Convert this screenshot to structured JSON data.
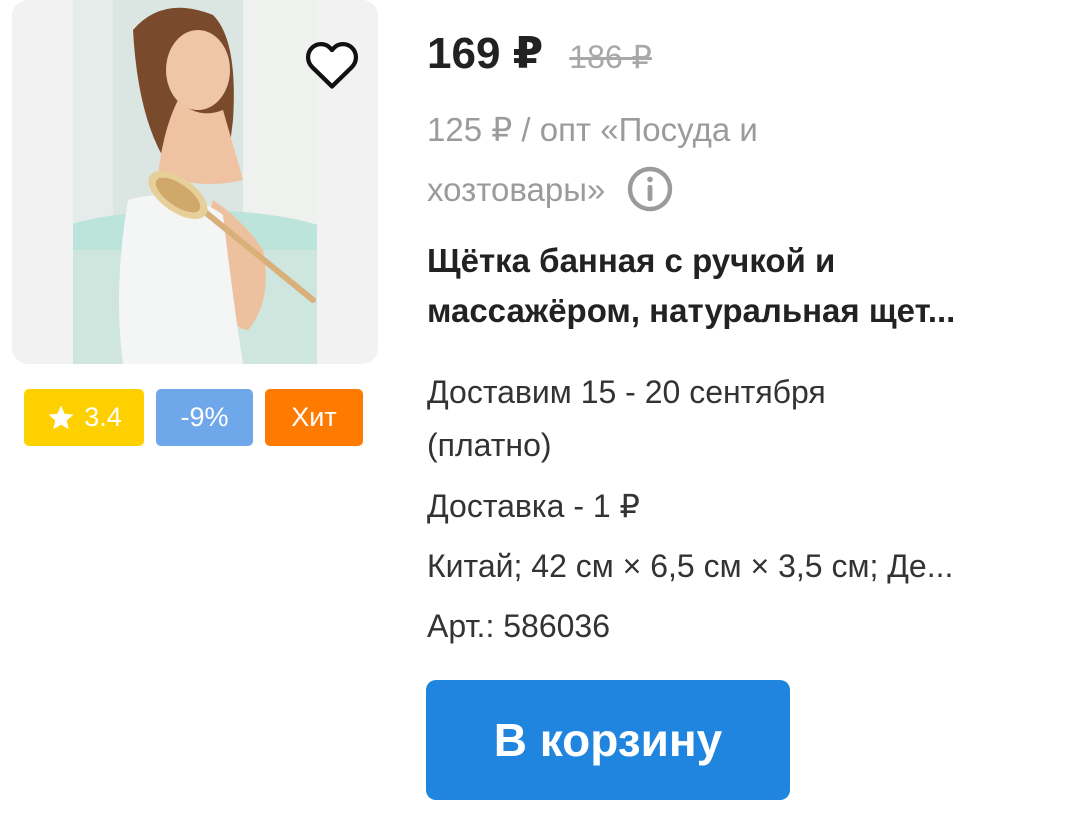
{
  "product": {
    "price": "169 ₽",
    "old_price": "186 ₽",
    "wholesale_line1": "125 ₽ / опт «Посуда и",
    "wholesale_line2": "хозтовары»",
    "title_line1": "Щётка банная с ручкой и",
    "title_line2": "массажёром, натуральная щет...",
    "delivery": "Доставим 15 - 20 сентября (платно)",
    "delivery_cost": "Доставка - 1 ₽",
    "specs": "Китай; 42 см × 6,5 см × 3,5 см; Де...",
    "article": "Арт.: 586036"
  },
  "badges": {
    "rating": "3.4",
    "discount": "-9%",
    "hit": "Хит"
  },
  "cart_button": {
    "label": "В корзину"
  },
  "icons": {
    "favorite": "heart-outline-icon",
    "info": "info-circle-icon",
    "rating": "star-icon"
  },
  "colors": {
    "rating_badge": "#ffd000",
    "discount_badge": "#6fa8ea",
    "hit_badge": "#ff7a00",
    "cart_button": "#1f85de",
    "muted_text": "#9b9b9b"
  }
}
